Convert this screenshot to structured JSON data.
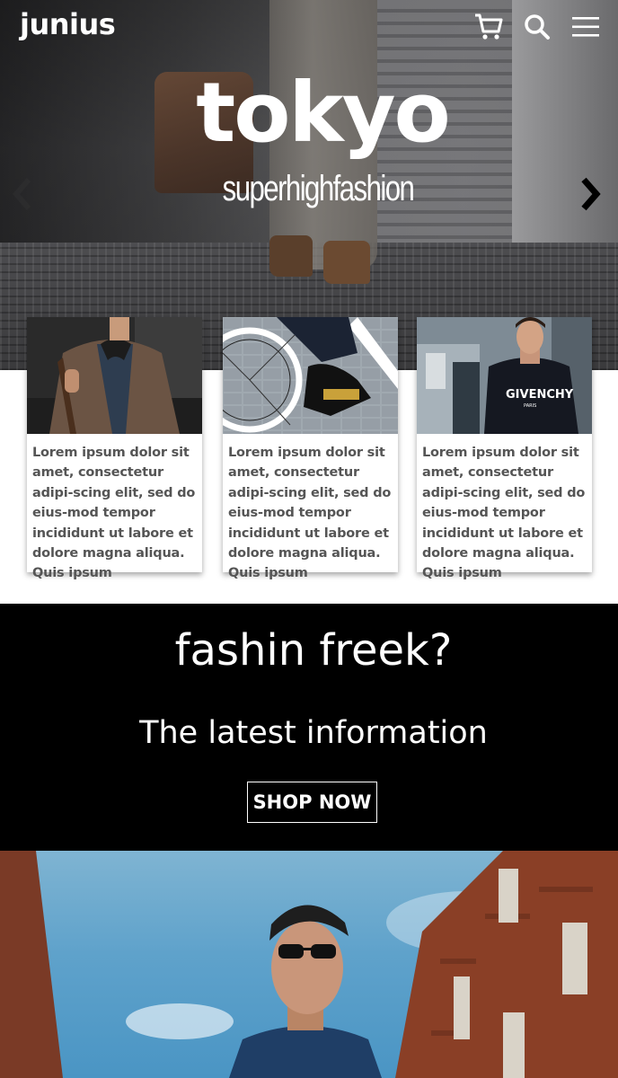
{
  "header": {
    "logo": "junius",
    "icons": [
      "cart-icon",
      "search-icon",
      "menu-icon"
    ]
  },
  "hero": {
    "title": "tokyo",
    "subtitle": "superhighfashion",
    "prev_icon": "chevron-left-icon",
    "next_icon": "chevron-right-icon"
  },
  "cards": [
    {
      "text": "Lorem ipsum dolor sit amet, consectetur adipi-scing elit, sed do eius-mod tempor incididunt ut labore et dolore magna aliqua. Quis ipsum"
    },
    {
      "text": "Lorem ipsum dolor sit amet, consectetur adipi-scing elit, sed do eius-mod tempor incididunt ut labore et dolore magna aliqua. Quis ipsum"
    },
    {
      "text": "Lorem ipsum dolor sit amet, consectetur adipi-scing elit, sed do eius-mod tempor incididunt ut labore et dolore magna aliqua. Quis ipsum"
    }
  ],
  "card_images": {
    "shirt_print": "GIVENCHY",
    "shirt_sub": "PARIS"
  },
  "promo": {
    "headline": "fashin freek?",
    "subheadline": "The latest information",
    "button_label": "SHOP NOW"
  },
  "colors": {
    "promo_background": "#000000",
    "card_text": "#555555",
    "sky": "#5fa2cb",
    "brick": "#8a3f26"
  }
}
